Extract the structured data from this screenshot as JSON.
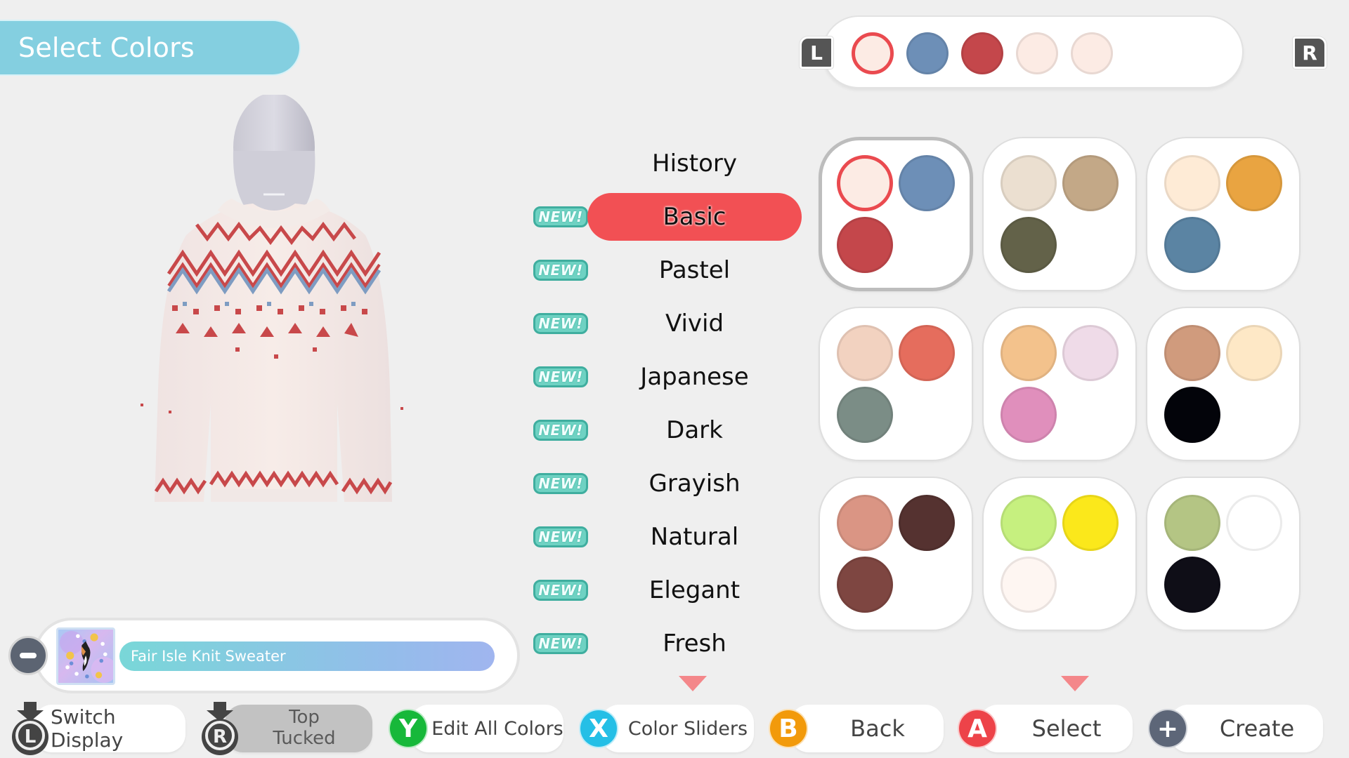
{
  "header": {
    "title": "Select Colors"
  },
  "history_bar": {
    "left_button": "L",
    "right_button": "R",
    "swatches": [
      {
        "color": "#fcebe4",
        "selected": true
      },
      {
        "color": "#6d8fb7",
        "selected": false
      },
      {
        "color": "#c4474b",
        "selected": false
      },
      {
        "color": "#fcebe4",
        "selected": false
      },
      {
        "color": "#fcebe4",
        "selected": false
      }
    ]
  },
  "categories": {
    "active": "Basic",
    "items": [
      {
        "label": "History",
        "new": false
      },
      {
        "label": "Basic",
        "new": true
      },
      {
        "label": "Pastel",
        "new": true
      },
      {
        "label": "Vivid",
        "new": true
      },
      {
        "label": "Japanese",
        "new": true
      },
      {
        "label": "Dark",
        "new": true
      },
      {
        "label": "Grayish",
        "new": true
      },
      {
        "label": "Natural",
        "new": true
      },
      {
        "label": "Elegant",
        "new": true
      },
      {
        "label": "Fresh",
        "new": true
      }
    ],
    "new_badge_label": "NEW!"
  },
  "palettes": [
    {
      "colors": [
        "#fcebe4",
        "#6d8fb7",
        "#c4474b"
      ],
      "selected": true
    },
    {
      "colors": [
        "#ebdfd0",
        "#c3a887",
        "#636249"
      ],
      "selected": false
    },
    {
      "colors": [
        "#feebd6",
        "#e9a441",
        "#5b84a3"
      ],
      "selected": false
    },
    {
      "colors": [
        "#f2d2c0",
        "#e56d5d",
        "#7b8d86"
      ],
      "selected": false
    },
    {
      "colors": [
        "#f3c28c",
        "#efdbe8",
        "#e08fbc"
      ],
      "selected": false
    },
    {
      "colors": [
        "#d09b7d",
        "#fee8c6",
        "#03040a"
      ],
      "selected": false
    },
    {
      "colors": [
        "#da9584",
        "#553230",
        "#7e4641"
      ],
      "selected": false
    },
    {
      "colors": [
        "#c6f07f",
        "#fbe81b",
        "#fef6f2"
      ],
      "selected": false
    },
    {
      "colors": [
        "#b4c584",
        "#ffffff",
        "#0f0e17"
      ],
      "selected": false
    }
  ],
  "item": {
    "name": "Fair Isle Knit Sweater",
    "minus_label": "−"
  },
  "actions": {
    "switch_display": {
      "button": "L",
      "label": "Switch Display"
    },
    "top_tucked": {
      "button": "R",
      "label_line1": "Top",
      "label_line2": "Tucked"
    },
    "edit_all_colors": {
      "button": "Y",
      "label": "Edit All Colors",
      "color": "#17b83a"
    },
    "color_sliders": {
      "button": "X",
      "label": "Color Sliders",
      "color": "#25bfe6"
    },
    "back": {
      "button": "B",
      "label": "Back",
      "color": "#f29a0b"
    },
    "select": {
      "button": "A",
      "label": "Select",
      "color": "#ed4349"
    },
    "create": {
      "button": "+",
      "label": "Create",
      "color": "#5d6678"
    }
  },
  "colors": {
    "banner": "#84cfe0",
    "active_category": "#f25054",
    "new_badge": "#6fd2c3",
    "scroll_arrow": "#f4878a",
    "background": "#efefef"
  }
}
